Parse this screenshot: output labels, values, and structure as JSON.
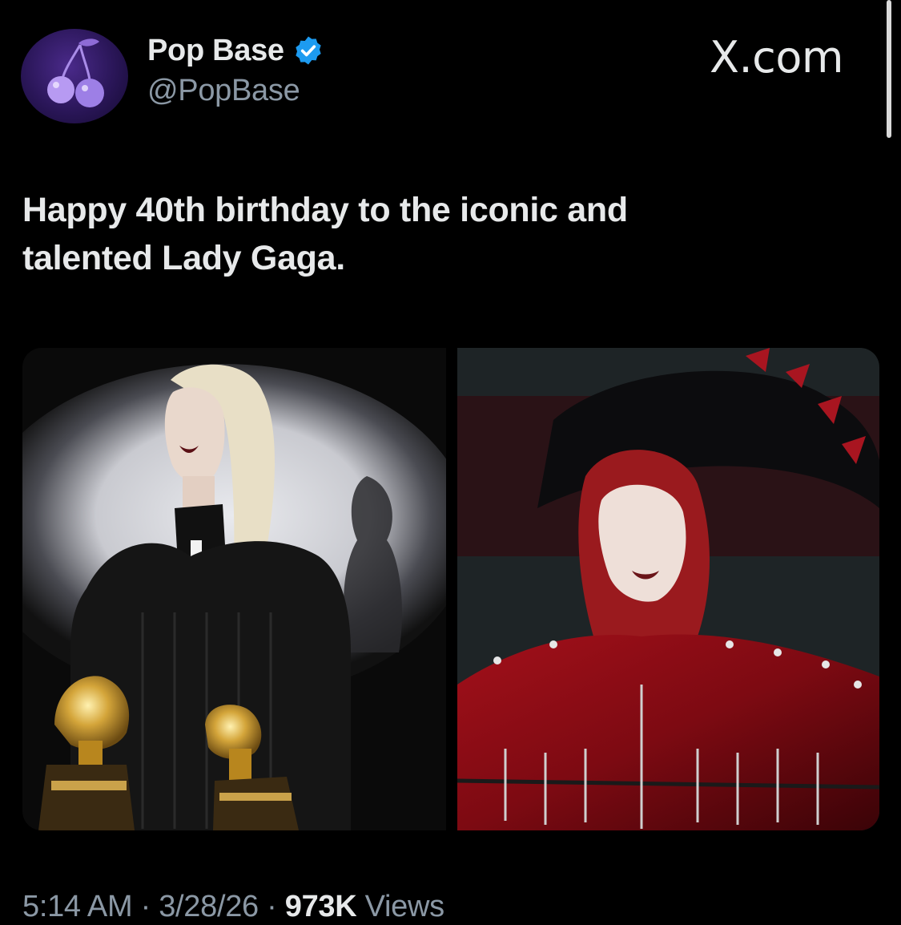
{
  "author": {
    "display_name": "Pop Base",
    "handle": "@PopBase",
    "verified_icon": "verified-badge-icon",
    "avatar_icon": "cherry-icon"
  },
  "brand": {
    "label": "X.com"
  },
  "tweet": {
    "text_line1": "Happy 40th birthday to the iconic and",
    "text_line2": "talented Lady Gaga."
  },
  "meta": {
    "time": "5:14 AM",
    "separator": " · ",
    "date": "3/28/26",
    "views_count": "973K",
    "views_label": " Views"
  },
  "colors": {
    "background": "#000000",
    "text_primary": "#e7e9ea",
    "text_secondary": "#8b98a5",
    "verified_blue": "#1d9bf0"
  }
}
